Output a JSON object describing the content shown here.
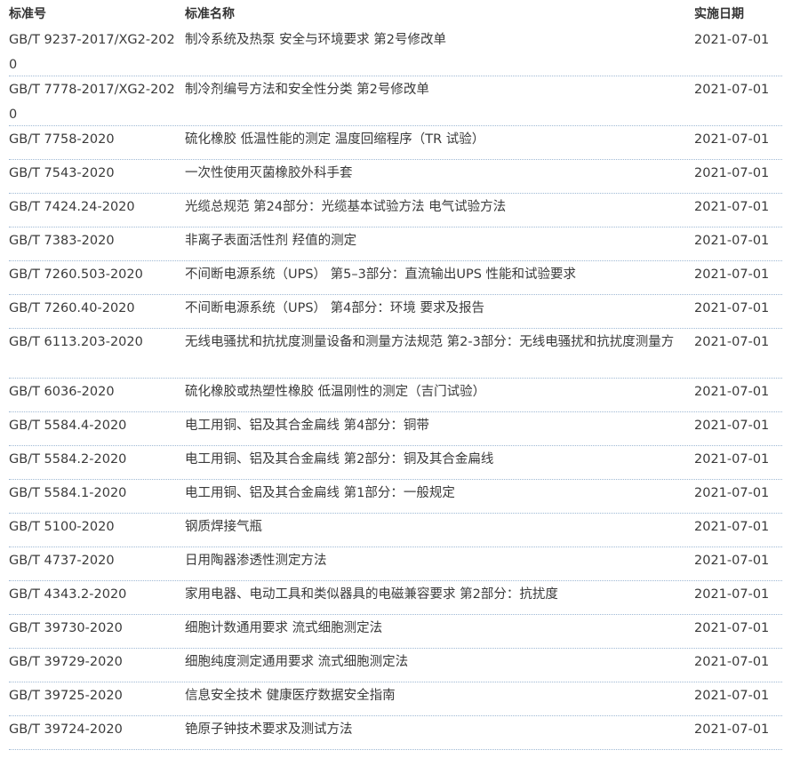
{
  "header": {
    "code": "标准号",
    "name": "标准名称",
    "date": "实施日期"
  },
  "rows": [
    {
      "code": "GB/T 9237-2017/XG2-2020",
      "name": "制冷系统及热泵 安全与环境要求 第2号修改单",
      "date": "2021-07-01"
    },
    {
      "code": "GB/T 7778-2017/XG2-2020",
      "name": "制冷剂编号方法和安全性分类 第2号修改单",
      "date": "2021-07-01"
    },
    {
      "code": "GB/T 7758-2020",
      "name": "硫化橡胶 低温性能的测定 温度回缩程序（TR 试验）",
      "date": "2021-07-01"
    },
    {
      "code": "GB/T 7543-2020",
      "name": "一次性使用灭菌橡胶外科手套",
      "date": "2021-07-01"
    },
    {
      "code": "GB/T 7424.24-2020",
      "name": "光缆总规范 第24部分：光缆基本试验方法 电气试验方法",
      "date": "2021-07-01"
    },
    {
      "code": "GB/T 7383-2020",
      "name": "非离子表面活性剂 羟值的测定",
      "date": "2021-07-01"
    },
    {
      "code": "GB/T 7260.503-2020",
      "name": "不间断电源系统（UPS） 第5–3部分：直流输出UPS 性能和试验要求",
      "date": "2021-07-01"
    },
    {
      "code": "GB/T 7260.40-2020",
      "name": "不间断电源系统（UPS） 第4部分：环境 要求及报告",
      "date": "2021-07-01"
    },
    {
      "code": "GB/T 6113.203-2020",
      "name": "无线电骚扰和抗扰度测量设备和测量方法规范 第2-3部分：无线电骚扰和抗扰度测量方",
      "date": "2021-07-01"
    },
    {
      "code": "GB/T 6036-2020",
      "name": "硫化橡胶或热塑性橡胶 低温刚性的测定（吉门试验）",
      "date": "2021-07-01"
    },
    {
      "code": "GB/T 5584.4-2020",
      "name": "电工用铜、铝及其合金扁线 第4部分：铜带",
      "date": "2021-07-01"
    },
    {
      "code": "GB/T 5584.2-2020",
      "name": "电工用铜、铝及其合金扁线 第2部分：铜及其合金扁线",
      "date": "2021-07-01"
    },
    {
      "code": "GB/T 5584.1-2020",
      "name": "电工用铜、铝及其合金扁线 第1部分：一般规定",
      "date": "2021-07-01"
    },
    {
      "code": "GB/T 5100-2020",
      "name": "钢质焊接气瓶",
      "date": "2021-07-01"
    },
    {
      "code": "GB/T 4737-2020",
      "name": "日用陶器渗透性测定方法",
      "date": "2021-07-01"
    },
    {
      "code": "GB/T 4343.2-2020",
      "name": "家用电器、电动工具和类似器具的电磁兼容要求 第2部分：抗扰度",
      "date": "2021-07-01"
    },
    {
      "code": "GB/T 39730-2020",
      "name": "细胞计数通用要求 流式细胞测定法",
      "date": "2021-07-01"
    },
    {
      "code": "GB/T 39729-2020",
      "name": "细胞纯度测定通用要求 流式细胞测定法",
      "date": "2021-07-01"
    },
    {
      "code": "GB/T 39725-2020",
      "name": "信息安全技术 健康医疗数据安全指南",
      "date": "2021-07-01"
    },
    {
      "code": "GB/T 39724-2020",
      "name": "铯原子钟技术要求及测试方法",
      "date": "2021-07-01"
    }
  ]
}
